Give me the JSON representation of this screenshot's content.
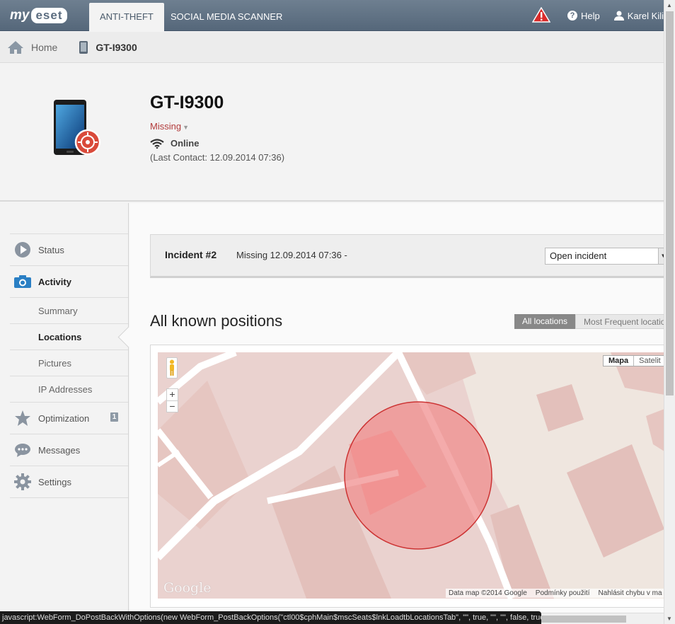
{
  "app": {
    "logo_my": "my",
    "logo_eset": "eset",
    "tabs": [
      {
        "label": "ANTI-THEFT",
        "active": true
      },
      {
        "label": "SOCIAL MEDIA SCANNER",
        "active": false
      }
    ],
    "help_label": "Help",
    "user_name": "Karel Kili",
    "warning_icon": "warning-icon"
  },
  "breadcrumb": {
    "home_label": "Home",
    "device_label": "GT-I9300"
  },
  "device": {
    "name": "GT-I9300",
    "status": "Missing",
    "connection": "Online",
    "last_contact": "(Last Contact: 12.09.2014 07:36)"
  },
  "sidebar": {
    "items": [
      {
        "label": "Status",
        "icon": "play-icon"
      },
      {
        "label": "Activity",
        "icon": "camera-icon",
        "active": true
      },
      {
        "label": "Summary"
      },
      {
        "label": "Locations",
        "active": true
      },
      {
        "label": "Pictures"
      },
      {
        "label": "IP Addresses"
      },
      {
        "label": "Optimization",
        "icon": "star-icon",
        "badge": "1"
      },
      {
        "label": "Messages",
        "icon": "chat-icon"
      },
      {
        "label": "Settings",
        "icon": "gear-icon"
      }
    ]
  },
  "incident": {
    "title": "Incident #2",
    "description": "Missing 12.09.2014 07:36 -",
    "select_value": "Open incident"
  },
  "positions": {
    "title": "All known positions",
    "toggle_all": "All locations",
    "toggle_frequent": "Most Frequent locatio"
  },
  "map": {
    "maptype_map": "Mapa",
    "maptype_satellite": "Satelit",
    "zoom_in": "+",
    "zoom_out": "−",
    "google_logo": "Google",
    "footer_data": "Data map ©2014 Google",
    "footer_terms": "Podmínky použití",
    "footer_report": "Nahlásit chybu v ma",
    "colors": {
      "background": "#ead2cf",
      "roads": "#ffffff",
      "buildings": "#e3c0bb",
      "circle_fill": "#f08a8a",
      "circle_stroke": "#cc3333"
    }
  },
  "statusbar": {
    "text": "javascript:WebForm_DoPostBackWithOptions(new WebForm_PostBackOptions(\"ctl00$cphMain$mscSeats$lnkLoadtbLocationsTab\", \"\", true, \"\", \"\", false, true))"
  }
}
